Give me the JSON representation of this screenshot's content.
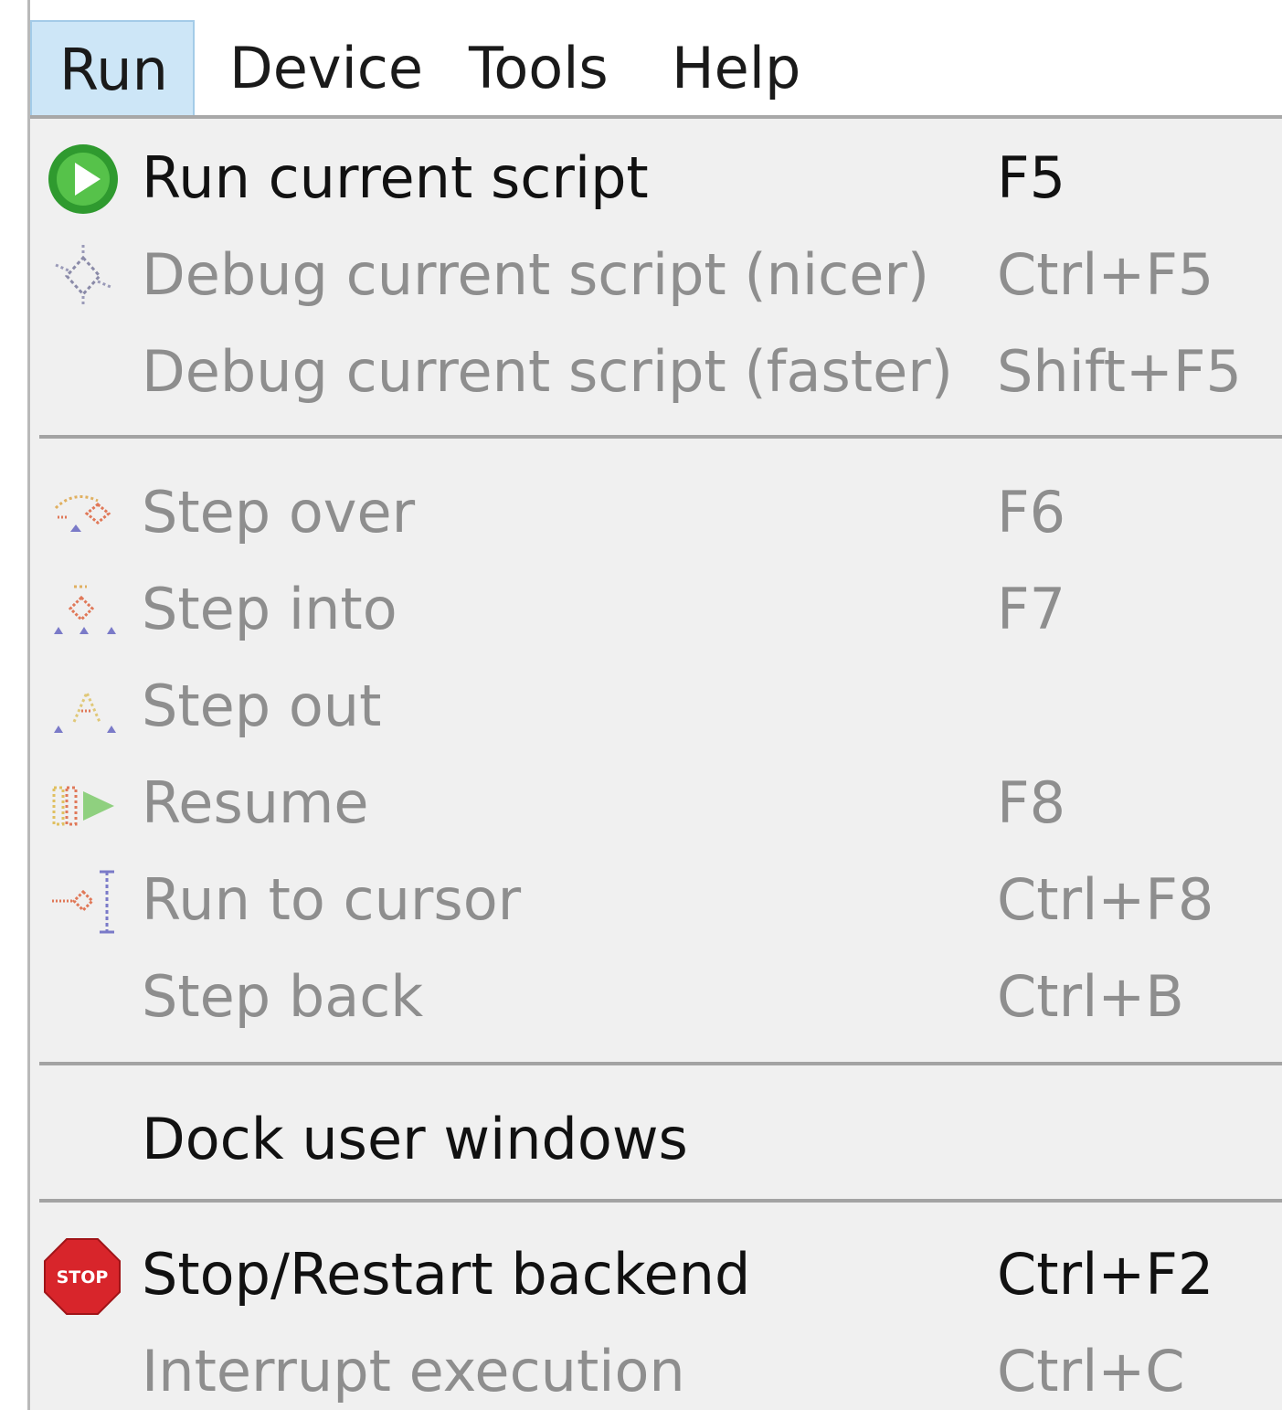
{
  "menubar": {
    "items": [
      {
        "label": "Run"
      },
      {
        "label": "Device"
      },
      {
        "label": "Tools"
      },
      {
        "label": "Help"
      }
    ]
  },
  "run_menu": {
    "items": [
      {
        "label": "Run current script",
        "shortcut": "F5",
        "icon": "run-icon",
        "enabled": true
      },
      {
        "label": "Debug current script (nicer)",
        "shortcut": "Ctrl+F5",
        "icon": "debug-icon",
        "enabled": false
      },
      {
        "label": "Debug current script (faster)",
        "shortcut": "Shift+F5",
        "icon": "",
        "enabled": false
      },
      {
        "label": "Step over",
        "shortcut": "F6",
        "icon": "step-over-icon",
        "enabled": false
      },
      {
        "label": "Step into",
        "shortcut": "F7",
        "icon": "step-into-icon",
        "enabled": false
      },
      {
        "label": "Step out",
        "shortcut": "",
        "icon": "step-out-icon",
        "enabled": false
      },
      {
        "label": "Resume",
        "shortcut": "F8",
        "icon": "resume-icon",
        "enabled": false
      },
      {
        "label": "Run to cursor",
        "shortcut": "Ctrl+F8",
        "icon": "run-to-cursor-icon",
        "enabled": false
      },
      {
        "label": "Step back",
        "shortcut": "Ctrl+B",
        "icon": "",
        "enabled": false
      },
      {
        "label": "Dock user windows",
        "shortcut": "",
        "icon": "",
        "enabled": true
      },
      {
        "label": "Stop/Restart backend",
        "shortcut": "Ctrl+F2",
        "icon": "stop-icon",
        "enabled": true
      },
      {
        "label": "Interrupt execution",
        "shortcut": "Ctrl+C",
        "icon": "",
        "enabled": false
      }
    ],
    "stop_icon_text": "STOP"
  },
  "colors": {
    "menu_background": "#f0f0f0",
    "active_menubar_item": "#cde6f7",
    "enabled_text": "#111111",
    "disabled_text": "#8e8e8e",
    "run_icon_green": "#2f9a2f",
    "stop_icon_red": "#d8252b"
  }
}
